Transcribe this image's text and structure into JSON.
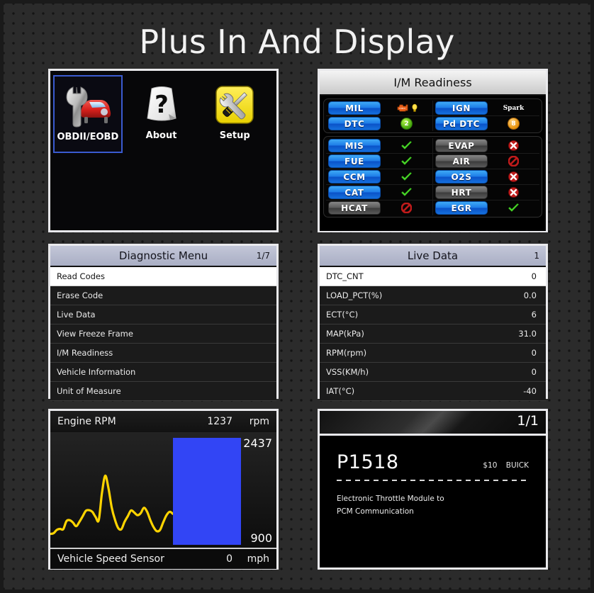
{
  "title": "Plus In And Display",
  "home": {
    "items": [
      {
        "label": "OBDII/EOBD",
        "icon": "wrench-car-icon",
        "selected": true
      },
      {
        "label": "About",
        "icon": "question-mark-icon",
        "selected": false
      },
      {
        "label": "Setup",
        "icon": "wrench-screwdriver-icon",
        "selected": false
      }
    ]
  },
  "im_readiness": {
    "title": "I/M Readiness",
    "top_rows": [
      {
        "left_label": "MIL",
        "left_style": "blue",
        "left_status": "engine-lamp-icon",
        "right_label": "IGN",
        "right_style": "blue",
        "right_status": "Spark"
      },
      {
        "left_label": "DTC",
        "left_style": "blue",
        "left_status": "2",
        "right_label": "Pd DTC",
        "right_style": "blue",
        "right_status": "8"
      }
    ],
    "monitor_rows": [
      {
        "left_label": "MIS",
        "left_style": "blue",
        "left_status": "check",
        "right_label": "EVAP",
        "right_style": "gray",
        "right_status": "cross"
      },
      {
        "left_label": "FUE",
        "left_style": "blue",
        "left_status": "check",
        "right_label": "AIR",
        "right_style": "gray",
        "right_status": "na"
      },
      {
        "left_label": "CCM",
        "left_style": "blue",
        "left_status": "check",
        "right_label": "O2S",
        "right_style": "blue",
        "right_status": "cross"
      },
      {
        "left_label": "CAT",
        "left_style": "blue",
        "left_status": "check",
        "right_label": "HRT",
        "right_style": "gray",
        "right_status": "cross"
      },
      {
        "left_label": "HCAT",
        "left_style": "gray",
        "left_status": "na",
        "right_label": "EGR",
        "right_style": "blue",
        "right_status": "check"
      }
    ]
  },
  "diagnostic_menu": {
    "title": "Diagnostic Menu",
    "page": "1/7",
    "items": [
      {
        "label": "Read Codes",
        "selected": true
      },
      {
        "label": "Erase Code",
        "selected": false
      },
      {
        "label": "Live Data",
        "selected": false
      },
      {
        "label": "View Freeze Frame",
        "selected": false
      },
      {
        "label": "I/M Readiness",
        "selected": false
      },
      {
        "label": "Vehicle Information",
        "selected": false
      },
      {
        "label": "Unit of Measure",
        "selected": false
      }
    ]
  },
  "live_data": {
    "title": "Live Data",
    "page": "1",
    "rows": [
      {
        "name": "DTC_CNT",
        "value": "0",
        "selected": true
      },
      {
        "name": "LOAD_PCT(%)",
        "value": "0.0",
        "selected": false
      },
      {
        "name": "ECT(°C)",
        "value": "6",
        "selected": false
      },
      {
        "name": "MAP(kPa)",
        "value": "31.0",
        "selected": false
      },
      {
        "name": "RPM(rpm)",
        "value": "0",
        "selected": false
      },
      {
        "name": "VSS(KM/h)",
        "value": "0",
        "selected": false
      },
      {
        "name": "IAT(°C)",
        "value": "-40",
        "selected": false
      }
    ]
  },
  "graph": {
    "top_label": "Engine RPM",
    "top_value": "1237",
    "top_unit": "rpm",
    "max_label": "2437",
    "min_label": "900",
    "bottom_label": "Vehicle Speed Sensor",
    "bottom_value": "0",
    "bottom_unit": "mph",
    "trace_color": "#ffd400",
    "bar_color": "#3245f5"
  },
  "dtc": {
    "page": "1/1",
    "code": "P1518",
    "module": "$10",
    "make": "BUICK",
    "description_line1": "Electronic Throttle Module to",
    "description_line2": "PCM Communication"
  },
  "chart_data": {
    "type": "line",
    "title": "Engine RPM",
    "ylabel": "rpm",
    "ylim": [
      900,
      2437
    ],
    "current_value": 1237,
    "grid": false,
    "x": [
      0,
      1,
      2,
      3,
      4,
      5,
      6,
      7,
      8,
      9,
      10,
      11,
      12,
      13,
      14,
      15,
      16,
      17,
      18,
      19,
      20,
      21,
      22,
      23,
      24,
      25,
      26,
      27,
      28,
      29,
      30,
      31,
      32,
      33,
      34,
      35,
      36,
      37,
      38
    ],
    "values": [
      1000,
      1010,
      1060,
      1075,
      1070,
      1190,
      1205,
      1170,
      1115,
      1180,
      1260,
      1345,
      1355,
      1330,
      1255,
      1205,
      1610,
      1870,
      1690,
      1400,
      1215,
      1090,
      1070,
      1180,
      1265,
      1350,
      1320,
      1280,
      1310,
      1390,
      1330,
      1205,
      1100,
      1040,
      1060,
      1175,
      1280,
      1330,
      1300
    ],
    "series": [
      {
        "name": "Engine RPM",
        "color": "#ffd400"
      }
    ]
  }
}
